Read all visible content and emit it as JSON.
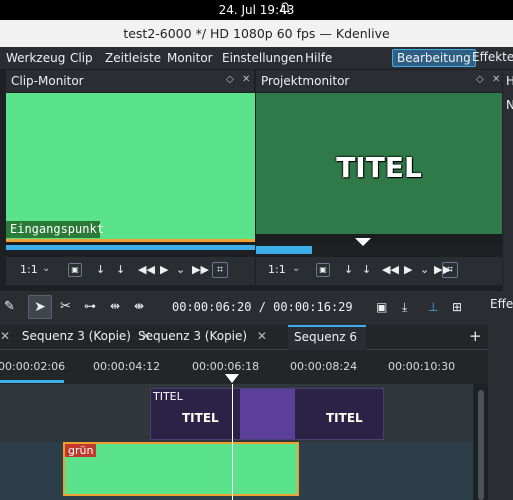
{
  "system": {
    "clock": "24. Jul  19:43"
  },
  "window": {
    "title": "test2-6000 */ HD 1080p 60 fps — Kdenlive"
  },
  "menu": {
    "items": [
      "Werkzeug",
      "Clip",
      "Zeitleiste",
      "Monitor",
      "Einstellungen",
      "Hilfe"
    ],
    "modes": [
      "Bearbeitung",
      "Effekte"
    ]
  },
  "clip_monitor": {
    "title": "Clip-Monitor",
    "marker_label": "Eingangspunkt",
    "zoom": "1:1",
    "color": "#5be38c"
  },
  "project_monitor": {
    "title": "Projektmonitor",
    "overlay_text": "TITEL",
    "zoom": "1:1",
    "color": "#2f7a48"
  },
  "right_dock": {
    "header": "H",
    "sub": "N"
  },
  "timeline": {
    "timecode": "00:00:06:20 / 00:00:16:29",
    "effects_label": "Effe",
    "tabs": [
      {
        "label": "Sequenz 3 (Kopie)"
      },
      {
        "label": "Sequenz 3 (Kopie)"
      },
      {
        "label": "Sequenz 6"
      }
    ],
    "ruler": [
      "00:00:02:06",
      "00:00:04:12",
      "00:00:06:18",
      "00:00:08:24",
      "00:00:10:30"
    ],
    "clips": {
      "title_group_label": "TITEL",
      "title_a": "TITEL",
      "title_b": "TITEL",
      "green_label": "grün"
    }
  },
  "colors": {
    "accent": "#3daee9",
    "selected_mode_bg": "#2f5f85",
    "green_clip": "#5be38c",
    "clip_border": "#f0a030"
  }
}
